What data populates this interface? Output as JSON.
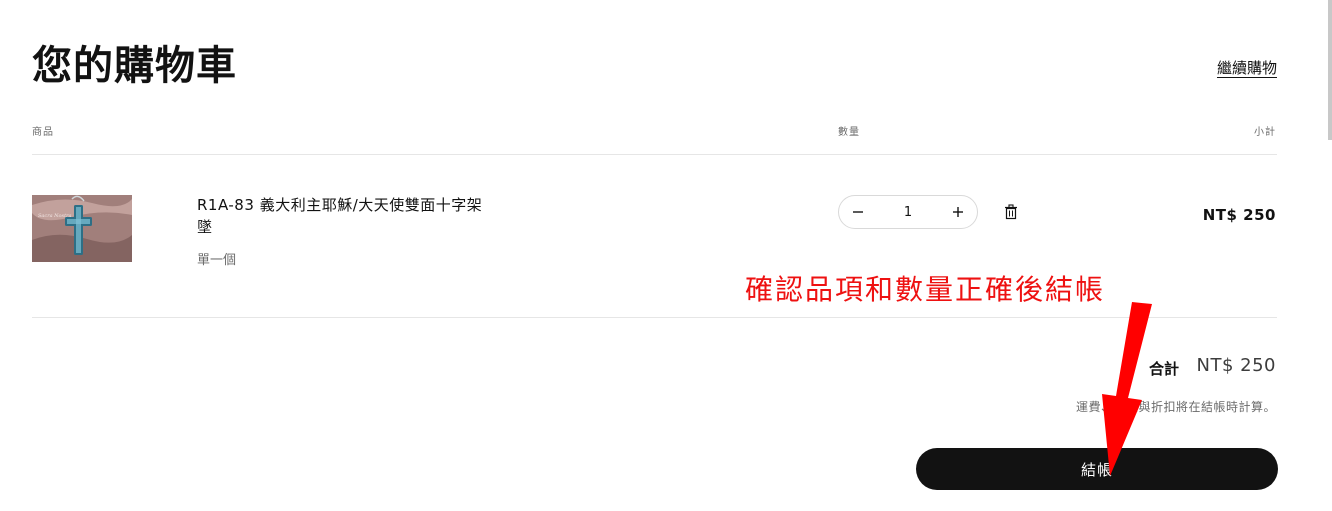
{
  "cart": {
    "title": "您的購物車",
    "continue_shopping": "繼續購物",
    "columns": {
      "product": "商品",
      "quantity": "數量",
      "total": "小計"
    },
    "items": [
      {
        "sku": "R1A-83",
        "name": "義大利主耶穌/大天使雙面十字架墜",
        "variant": "單一個",
        "quantity": "1",
        "price": "NT$ 250",
        "thumbnail_caption": "rpsn.com"
      }
    ],
    "subtotal_label": "合計",
    "subtotal_value": "NT$ 250",
    "tax_note": "運費、稅金與折扣將在結帳時計算。",
    "checkout_label": "結帳"
  },
  "annotation": {
    "text": "確認品項和數量正確後結帳",
    "color": "#ee1111"
  },
  "icons": {
    "minus": "minus-icon",
    "plus": "plus-icon",
    "trash": "trash-icon"
  }
}
